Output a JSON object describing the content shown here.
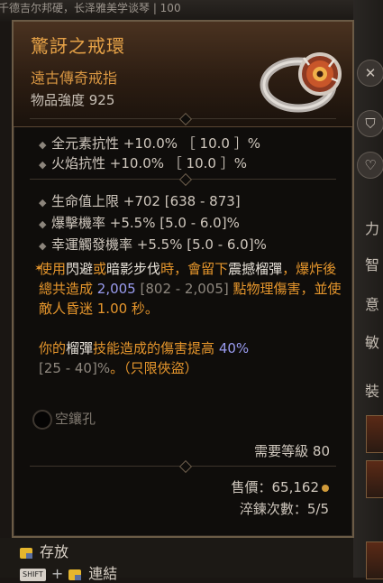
{
  "background": {
    "top_text": "千德吉尔邦硬，长泽雅美学谈琴 | 100"
  },
  "right_panel": {
    "labels": [
      "力",
      "智",
      "意",
      "敏"
    ],
    "section_label": "裝"
  },
  "item": {
    "name": "驚訝之戒環",
    "type": "遠古傳奇戒指",
    "power": "物品強度 925"
  },
  "implicit_stats": [
    {
      "text": "全元素抗性 +10.0% ［ 10.0 ］%"
    },
    {
      "text": "火焰抗性 +10.0% ［ 10.0 ］%"
    }
  ],
  "affix_stats": [
    {
      "text": "生命值上限 +702 [638 - 873]"
    },
    {
      "text": "爆擊機率 +5.5% [5.0 - 6.0]%"
    },
    {
      "text": "幸運觸發機率 +5.5% [5.0 - 6.0]%"
    }
  ],
  "aspect": {
    "p1": "使用",
    "k1": "閃避",
    "p2": "或",
    "k2": "暗影步伐",
    "p3": "時，會留下",
    "k3": "震撼榴彈",
    "p4": "，爆炸後總共造成 ",
    "v1": "2,005",
    "r1": " [802 - 2,005] ",
    "p5": "點物理傷害，並使敵人昏迷 1.00 秒。",
    "q1": "你的",
    "k4": "榴彈",
    "q2": "技能造成的傷害提高 ",
    "v2": "40%",
    "r2": "[25 - 40]%",
    "q3": "。（只限俠盜）"
  },
  "socket_label": "空鑲孔",
  "required_level": "需要等級 80",
  "sell_price": "售價：65,162",
  "temper_count": "淬鍊次數：5/5",
  "actions": {
    "stash": "存放",
    "link_key": "SHIFT",
    "link": "連結"
  },
  "colors": {
    "legendary_orange": "#e6a247",
    "value_blue": "#9a9cf0",
    "frame": "#6b5b46"
  }
}
